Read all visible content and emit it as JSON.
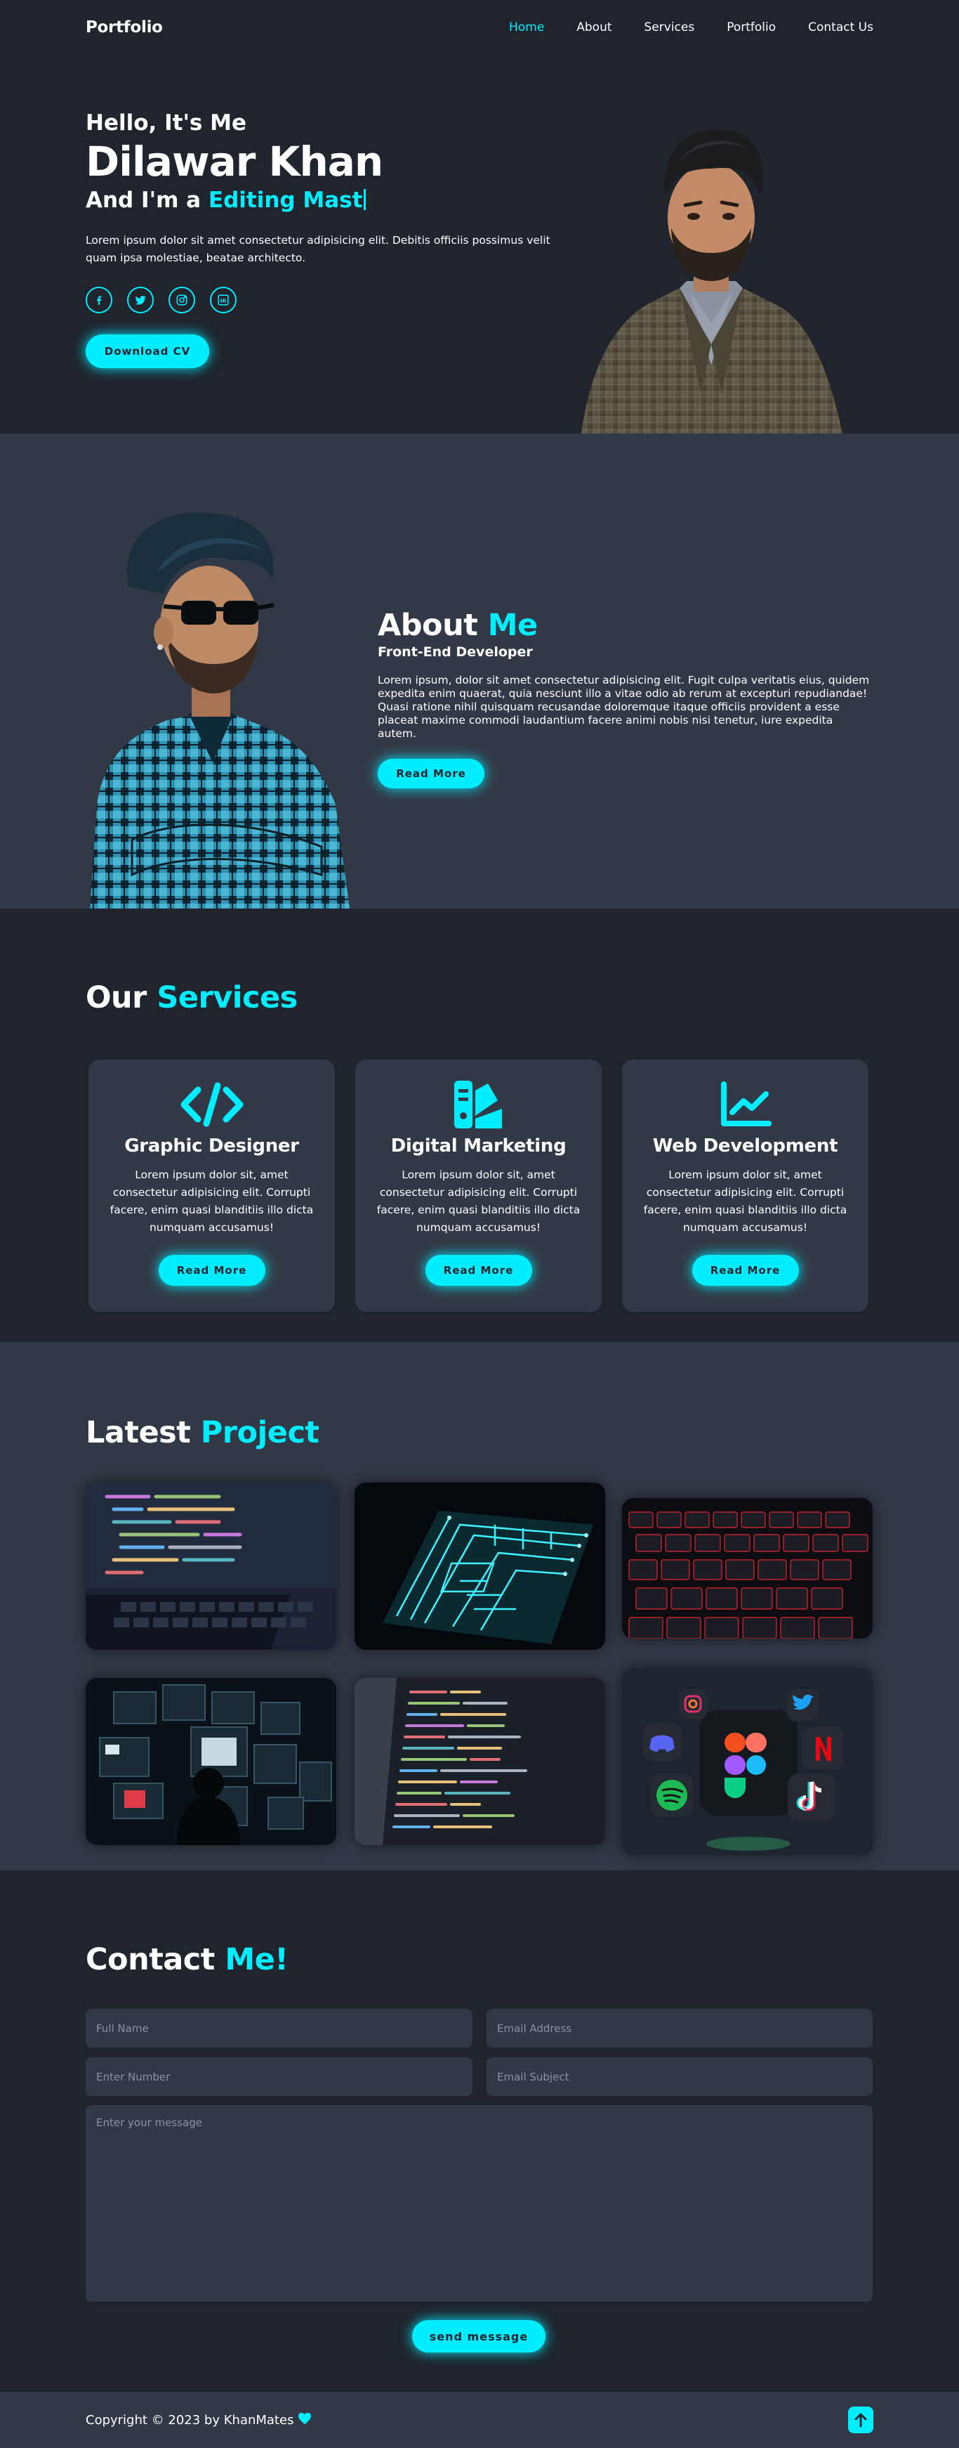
{
  "header": {
    "logo": "Portfolio",
    "nav": [
      "Home",
      "About",
      "Services",
      "Portfolio",
      "Contact Us"
    ],
    "active": "Home"
  },
  "home": {
    "greeting": "Hello, It's Me",
    "name": "Dilawar Khan",
    "role_prefix": "And I'm a",
    "role_typed": "Editing Mast",
    "description": "Lorem ipsum dolor sit amet consectetur adipisicing elit. Debitis officiis possimus velit quam ipsa molestiae, beatae architecto.",
    "socials": [
      "facebook-icon",
      "twitter-icon",
      "instagram-icon",
      "linkedin-icon"
    ],
    "cv_button": "Download CV"
  },
  "about": {
    "title": "About",
    "title_accent": "Me",
    "subtitle": "Front-End Developer",
    "text": "Lorem ipsum, dolor sit amet consectetur adipisicing elit. Fugit culpa veritatis eius, quidem expedita enim quaerat, quia nesciunt illo a vitae odio ab rerum at excepturi repudiandae! Quasi ratione nihil quisquam recusandae doloremque itaque officiis provident a esse placeat maxime commodi laudantium facere animi nobis nisi tenetur, iure expedita autem.",
    "button": "Read More"
  },
  "services": {
    "title": "Our",
    "title_accent": "Services",
    "items": [
      {
        "icon": "code-icon",
        "title": "Graphic Designer",
        "text": "Lorem ipsum dolor sit, amet consectetur adipisicing elit. Corrupti facere, enim quasi blanditiis illo dicta numquam accusamus!",
        "button": "Read More"
      },
      {
        "icon": "swatchbook-icon",
        "title": "Digital Marketing",
        "text": "Lorem ipsum dolor sit, amet consectetur adipisicing elit. Corrupti facere, enim quasi blanditiis illo dicta numquam accusamus!",
        "button": "Read More"
      },
      {
        "icon": "chart-line-icon",
        "title": "Web Development",
        "text": "Lorem ipsum dolor sit, amet consectetur adipisicing elit. Corrupti facere, enim quasi blanditiis illo dicta numquam accusamus!",
        "button": "Read More"
      }
    ]
  },
  "portfolio": {
    "title": "Latest",
    "title_accent": "Project"
  },
  "contact": {
    "title": "Contact",
    "title_accent": "Me!",
    "placeholders": {
      "name": "Full Name",
      "email": "Email Address",
      "number": "Enter Number",
      "subject": "Email Subject",
      "message": "Enter your message"
    },
    "send_button": "send message"
  },
  "footer": {
    "copyright": "Copyright © 2023 by KhanMates"
  },
  "colors": {
    "accent": "#00eeff",
    "bg": "#1f242d",
    "bg_alt": "#323946"
  }
}
